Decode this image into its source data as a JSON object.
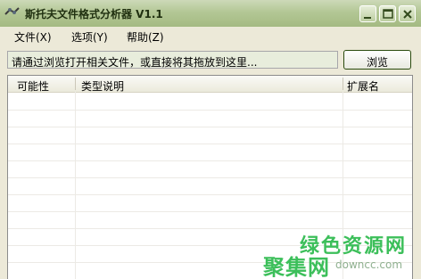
{
  "window": {
    "title": "斯托夫文件格式分析器 V1.1"
  },
  "menu": [
    "文件(X)",
    "选项(Y)",
    "帮助(Z)"
  ],
  "path_field": {
    "text": "请通过浏览打开相关文件，或直接将其拖放到这里..."
  },
  "browse_button": {
    "label": "浏览"
  },
  "list": {
    "columns": [
      "可能性",
      "类型说明",
      "扩展名"
    ]
  },
  "watermark": {
    "line1": "绿色资源网",
    "line2": "聚集网",
    "url": "downcc.com"
  },
  "colors": {
    "titlebar": "#b3c795",
    "window_bg": "#ece9d8",
    "watermark": "#3cbf5a"
  }
}
